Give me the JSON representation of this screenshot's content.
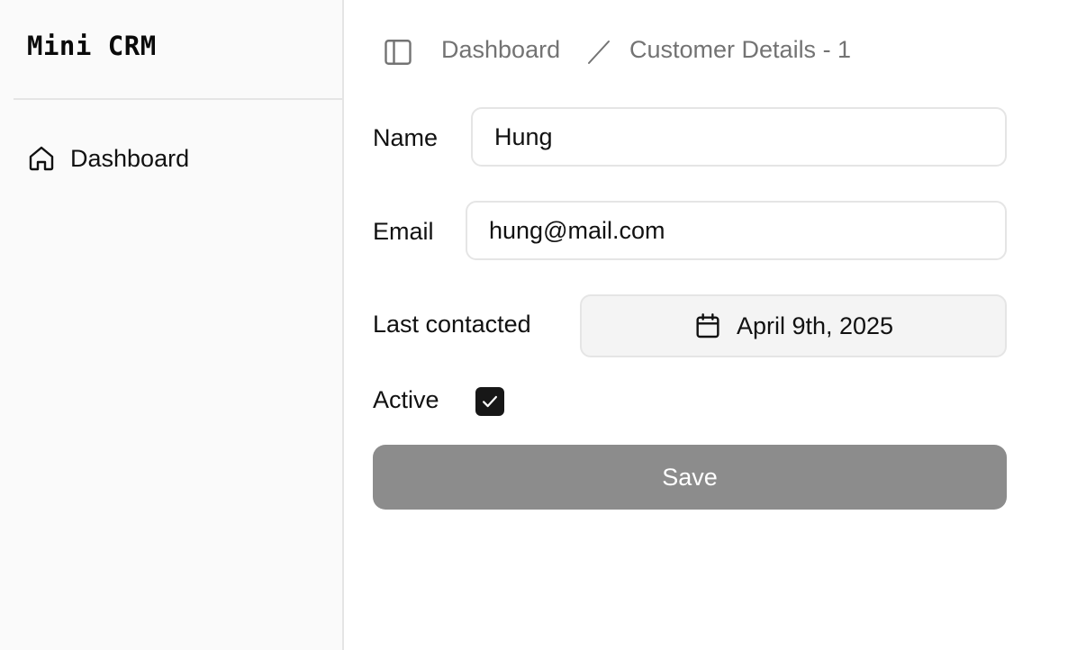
{
  "app": {
    "title": "Mini CRM"
  },
  "sidebar": {
    "items": [
      {
        "label": "Dashboard",
        "icon": "home-icon"
      }
    ]
  },
  "header": {
    "toggle_icon": "sidebar-toggle-icon",
    "breadcrumb": {
      "parent": "Dashboard",
      "current": "Customer Details - 1"
    }
  },
  "form": {
    "name": {
      "label": "Name",
      "value": "Hung"
    },
    "email": {
      "label": "Email",
      "value": "hung@mail.com"
    },
    "last_contacted": {
      "label": "Last contacted",
      "value": "April 9th, 2025",
      "icon": "calendar-icon"
    },
    "active": {
      "label": "Active",
      "checked": true
    },
    "save_label": "Save"
  },
  "colors": {
    "sidebar_bg": "#fafafa",
    "border": "#e5e5e5",
    "muted_text": "#737373",
    "save_button_bg": "#8c8c8c",
    "checkbox_bg": "#171717"
  }
}
